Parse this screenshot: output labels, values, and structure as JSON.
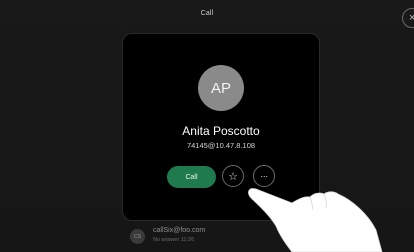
{
  "header": {
    "title": "Call",
    "close_icon": "close-icon"
  },
  "contact": {
    "initials": "AP",
    "name": "Anita Poscotto",
    "number": "74145@10.47.8.108"
  },
  "actions": {
    "call_label": "Call",
    "favorite_icon": "star-icon",
    "more_icon": "more-icon",
    "favorite_glyph": "☆",
    "more_glyph": "···"
  },
  "recent": {
    "initials": "CS",
    "title": "callSix@foo.com",
    "subtitle": "No answer 11:26"
  },
  "colors": {
    "call_button": "#1f7a4d",
    "avatar": "#8a8a8a",
    "card": "#000000"
  }
}
